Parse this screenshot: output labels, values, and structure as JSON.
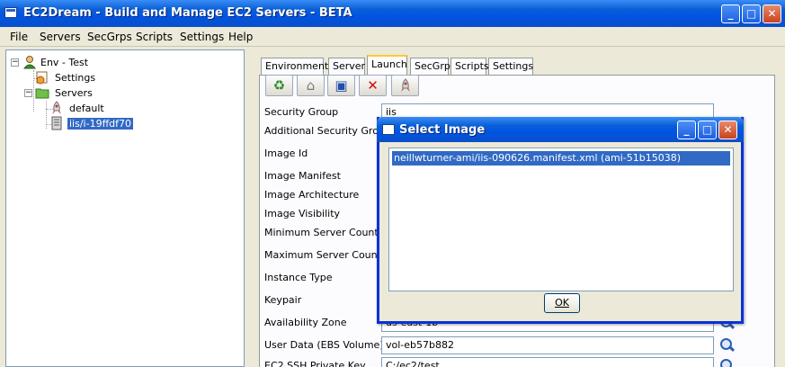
{
  "window": {
    "title": "EC2Dream - Build and Manage EC2 Servers - BETA"
  },
  "menu": [
    "File",
    "Servers",
    "SecGrps",
    "Scripts",
    "Settings",
    "Help"
  ],
  "tree": {
    "root": "Env - Test",
    "settings": "Settings",
    "servers": "Servers",
    "children": [
      "default",
      "iis/i-19ffdf70"
    ]
  },
  "tabs": [
    "Environment",
    "Server",
    "Launch",
    "SecGrp",
    "Scripts",
    "Settings"
  ],
  "active_tab": "Launch",
  "form": {
    "labels": {
      "security_group": "Security Group",
      "additional_security_groups": "Additional Security Groups",
      "image_id": "Image Id",
      "image_manifest": "Image Manifest",
      "image_architecture": "Image Architecture",
      "image_visibility": "Image Visibility",
      "min_server_count": "Minimum Server Count",
      "max_server_count": "Maximum Server Count",
      "instance_type": "Instance Type",
      "keypair": "Keypair",
      "availability_zone": "Availability Zone",
      "user_data": "User Data (EBS Volume)",
      "ec2_ssh_private_key": "EC2 SSH Private Key"
    },
    "values": {
      "security_group": "iis",
      "availability_zone": "us-east-1b",
      "user_data": "vol-eb57b882",
      "ec2_ssh_private_key": "C:/ec2/test"
    }
  },
  "dialog": {
    "title": "Select Image",
    "items": [
      "neillwturner-ami/iis-090626.manifest.xml  (ami-51b15038)"
    ],
    "ok_label": "OK"
  }
}
